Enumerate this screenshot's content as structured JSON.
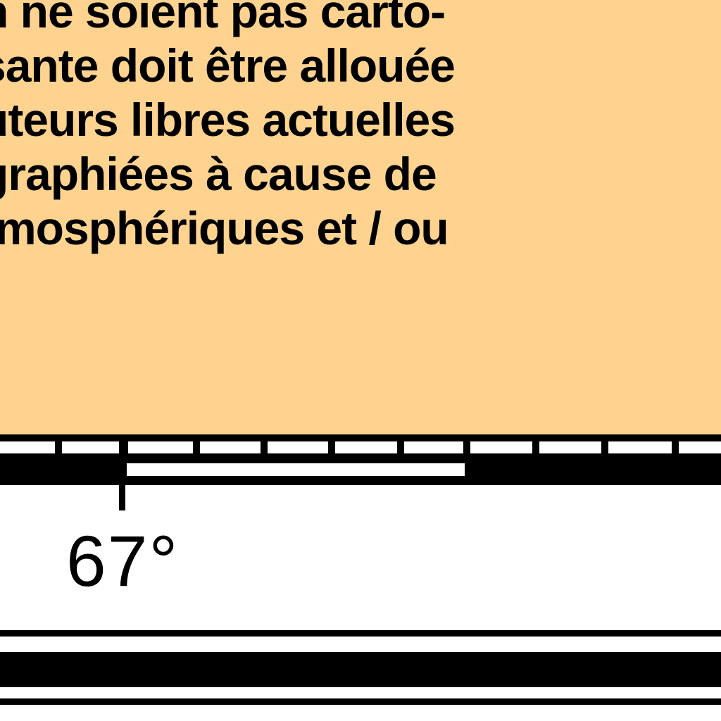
{
  "legend": {
    "lines": [
      "n ne soient pas carto-",
      "sante doit être allouée",
      "uteurs libres actuelles",
      "graphiées à cause de",
      "tmosphériques et / ou"
    ]
  },
  "map_frame": {
    "latitude_label": "67°"
  },
  "colors": {
    "legend_fill": "#fdd38f",
    "frame": "#000000",
    "paper": "#ffffff"
  }
}
